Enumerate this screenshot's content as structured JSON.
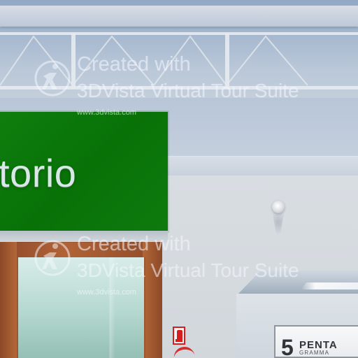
{
  "scene": {
    "green_sign_text": "torio",
    "company_sign": {
      "number": "5",
      "title": "PENTA",
      "subtitle": "GRAMMA"
    }
  },
  "watermarks": [
    {
      "line1": "Created with",
      "line2": "3DVista Virtual Tour Suite",
      "url": "www.3dvista.com"
    },
    {
      "line1": "Created with",
      "line2": "3DVista Virtual Tour Suite",
      "url": "www.3dvista.com"
    }
  ],
  "colors": {
    "green_sign": "#087207",
    "wood": "#b16336",
    "glass": "#b4d8cf",
    "watermark": "#f5f8ff",
    "fire_sign": "#d71e1e"
  },
  "icons": {
    "watermark_logo": "3dvista-person-icon",
    "fire_extinguisher_sign": "fire-extinguisher-sign-icon",
    "ceiling_light": "ceiling-light-icon"
  }
}
